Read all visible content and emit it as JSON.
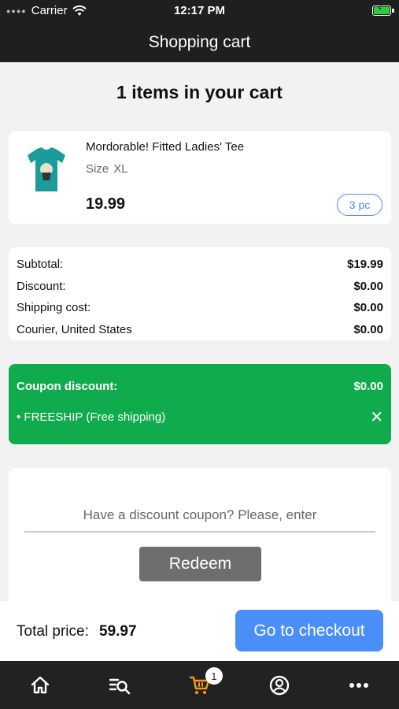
{
  "status_bar": {
    "carrier": "Carrier",
    "time": "12:17 PM"
  },
  "header": {
    "title": "Shopping cart"
  },
  "cart": {
    "heading": "1 items in your cart"
  },
  "product": {
    "name": "Mordorable! Fitted Ladies' Tee",
    "size_label": "Size",
    "size_value": "XL",
    "price": "19.99",
    "quantity": "3 pc",
    "image_icon": "tshirt-image",
    "image_color": "#1a9c9c"
  },
  "summary": {
    "rows": [
      {
        "label": "Subtotal:",
        "value": "$19.99"
      },
      {
        "label": "Discount:",
        "value": "$0.00"
      },
      {
        "label": "Shipping cost:",
        "value": "$0.00"
      },
      {
        "label": "Courier, United States",
        "value": "$0.00"
      }
    ]
  },
  "coupon": {
    "title": "Coupon discount:",
    "amount": "$0.00",
    "item": "•  FREESHIP (Free shipping)",
    "color": "#10ab4c"
  },
  "redeem": {
    "placeholder": "Have a discount coupon? Please, enter",
    "button_label": "Redeem"
  },
  "checkout": {
    "total_label": "Total price:",
    "total_value": "59.97",
    "button_label": "Go to checkout",
    "accent": "#4a8ef8"
  },
  "tab_bar": {
    "tabs": [
      {
        "icon": "home-icon"
      },
      {
        "icon": "search-list-icon"
      },
      {
        "icon": "cart-icon",
        "badge": "1",
        "active_color": "#f29a1b"
      },
      {
        "icon": "profile-icon"
      },
      {
        "icon": "more-icon"
      }
    ]
  }
}
